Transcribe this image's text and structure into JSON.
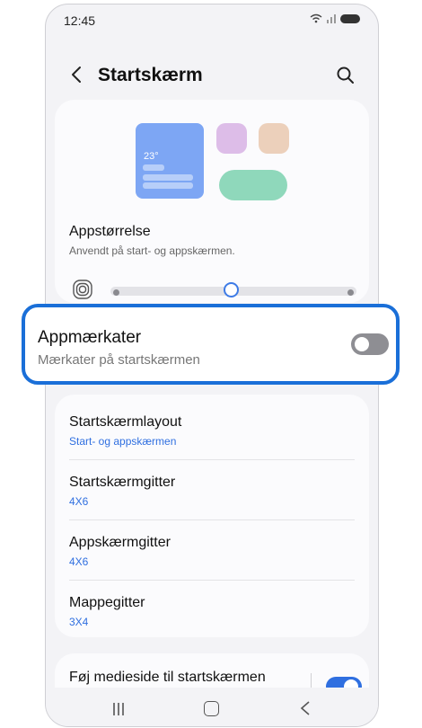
{
  "status_bar": {
    "time": "12:45"
  },
  "header": {
    "title": "Startskærm"
  },
  "preview": {
    "widget_temp": "23°",
    "colors": {
      "widget": "#7da6f4",
      "app1": "#ddbde8",
      "app2": "#ecd0bb",
      "app3": "#8fd8bb"
    }
  },
  "app_size": {
    "label": "Appstørrelse",
    "description": "Anvendt på start- og appskærmen.",
    "slider_position_fraction": 0.5
  },
  "app_labels": {
    "title": "Appmærkater",
    "subtitle": "Mærkater på startskærmen",
    "enabled": false
  },
  "settings": [
    {
      "title": "Startskærmlayout",
      "value": "Start- og appskærmen"
    },
    {
      "title": "Startskærmgitter",
      "value": "4X6"
    },
    {
      "title": "Appskærmgitter",
      "value": "4X6"
    },
    {
      "title": "Mappegitter",
      "value": "3X4"
    }
  ],
  "media_page": {
    "title": "Føj medieside til startskærmen",
    "enabled": true
  },
  "colors": {
    "accent": "#2f6fe0",
    "highlight_border": "#1a6fd8"
  }
}
